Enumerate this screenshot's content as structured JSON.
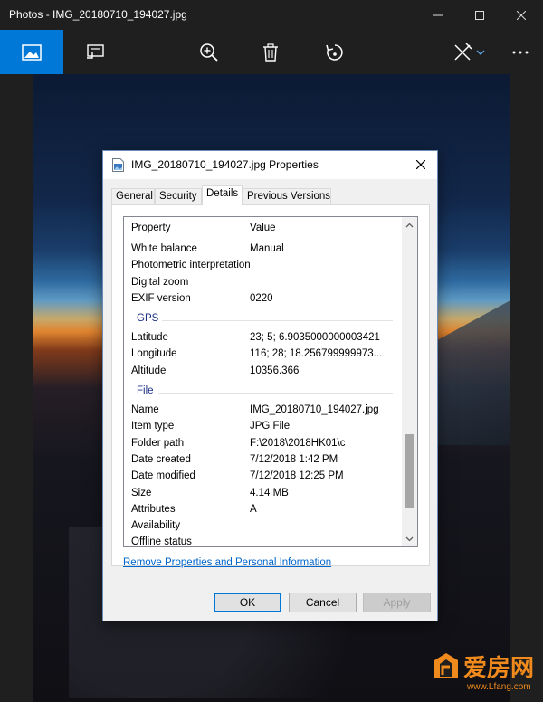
{
  "app": {
    "window_title": "Photos - IMG_20180710_194027.jpg"
  },
  "toolbar": {
    "icons": [
      "image-icon",
      "slideshow-icon",
      "zoom-icon",
      "delete-icon",
      "rotate-icon",
      "edit-icon",
      "more-icon"
    ],
    "accent_color": "#0078d7"
  },
  "dialog": {
    "title": "IMG_20180710_194027.jpg Properties",
    "tabs": [
      "General",
      "Security",
      "Details",
      "Previous Versions"
    ],
    "selected_tab": "Details",
    "columns": {
      "property": "Property",
      "value": "Value"
    },
    "rows_top": [
      {
        "k": "White balance",
        "v": "Manual"
      },
      {
        "k": "Photometric interpretation",
        "v": ""
      },
      {
        "k": "Digital zoom",
        "v": ""
      },
      {
        "k": "EXIF version",
        "v": "0220"
      }
    ],
    "gps_group": "GPS",
    "rows_gps": [
      {
        "k": "Latitude",
        "v": "23; 5; 6.9035000000003421"
      },
      {
        "k": "Longitude",
        "v": "116; 28; 18.256799999973..."
      },
      {
        "k": "Altitude",
        "v": "10356.366"
      }
    ],
    "file_group": "File",
    "rows_file": [
      {
        "k": "Name",
        "v": "IMG_20180710_194027.jpg"
      },
      {
        "k": "Item type",
        "v": "JPG File"
      },
      {
        "k": "Folder path",
        "v": "F:\\2018\\2018HK01\\c"
      },
      {
        "k": "Date created",
        "v": "7/12/2018 1:42 PM"
      },
      {
        "k": "Date modified",
        "v": "7/12/2018 12:25 PM"
      },
      {
        "k": "Size",
        "v": "4.14 MB"
      },
      {
        "k": "Attributes",
        "v": "A"
      },
      {
        "k": "Availability",
        "v": ""
      },
      {
        "k": "Offline status",
        "v": ""
      }
    ],
    "link": "Remove Properties and Personal Information",
    "buttons": {
      "ok": "OK",
      "cancel": "Cancel",
      "apply": "Apply"
    }
  },
  "watermark": {
    "text": "爱房网",
    "url": "www.Lfang.com"
  }
}
